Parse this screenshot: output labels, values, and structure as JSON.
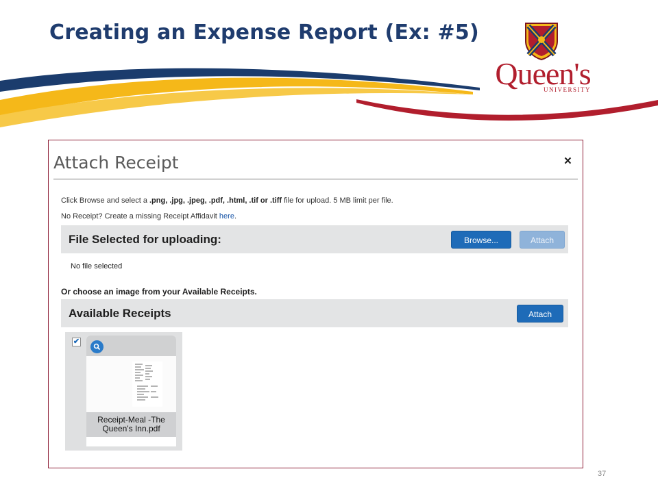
{
  "slide": {
    "title": "Creating an Expense Report (Ex: #5)",
    "page_number": "37",
    "logo": {
      "wordmark": "Queen's",
      "subtext": "UNIVERSITY"
    }
  },
  "dialog": {
    "title": "Attach Receipt",
    "close_icon": "×",
    "instructions_prefix": "Click Browse and select a ",
    "instructions_types": ".png, .jpg, .jpeg, .pdf, .html, .tif or .tiff",
    "instructions_suffix": " file for upload. 5 MB limit per file.",
    "missing_prefix": "No Receipt? Create a missing Receipt Affidavit ",
    "missing_link": "here",
    "missing_suffix": ".",
    "file_section": {
      "title": "File Selected for uploading:",
      "browse_label": "Browse...",
      "attach_label": "Attach",
      "status": "No file selected"
    },
    "choose_text": "Or choose an image from your Available Receipts.",
    "available_section": {
      "title": "Available Receipts",
      "attach_label": "Attach"
    },
    "receipts": [
      {
        "caption": "Receipt-Meal -The Queen's Inn.pdf",
        "checked": true
      }
    ]
  },
  "colors": {
    "title_blue": "#1f3c6e",
    "button_blue": "#1e6bb8",
    "brand_red": "#b11e2d",
    "brand_gold": "#f5b819",
    "brand_navy": "#1b3c6d"
  }
}
